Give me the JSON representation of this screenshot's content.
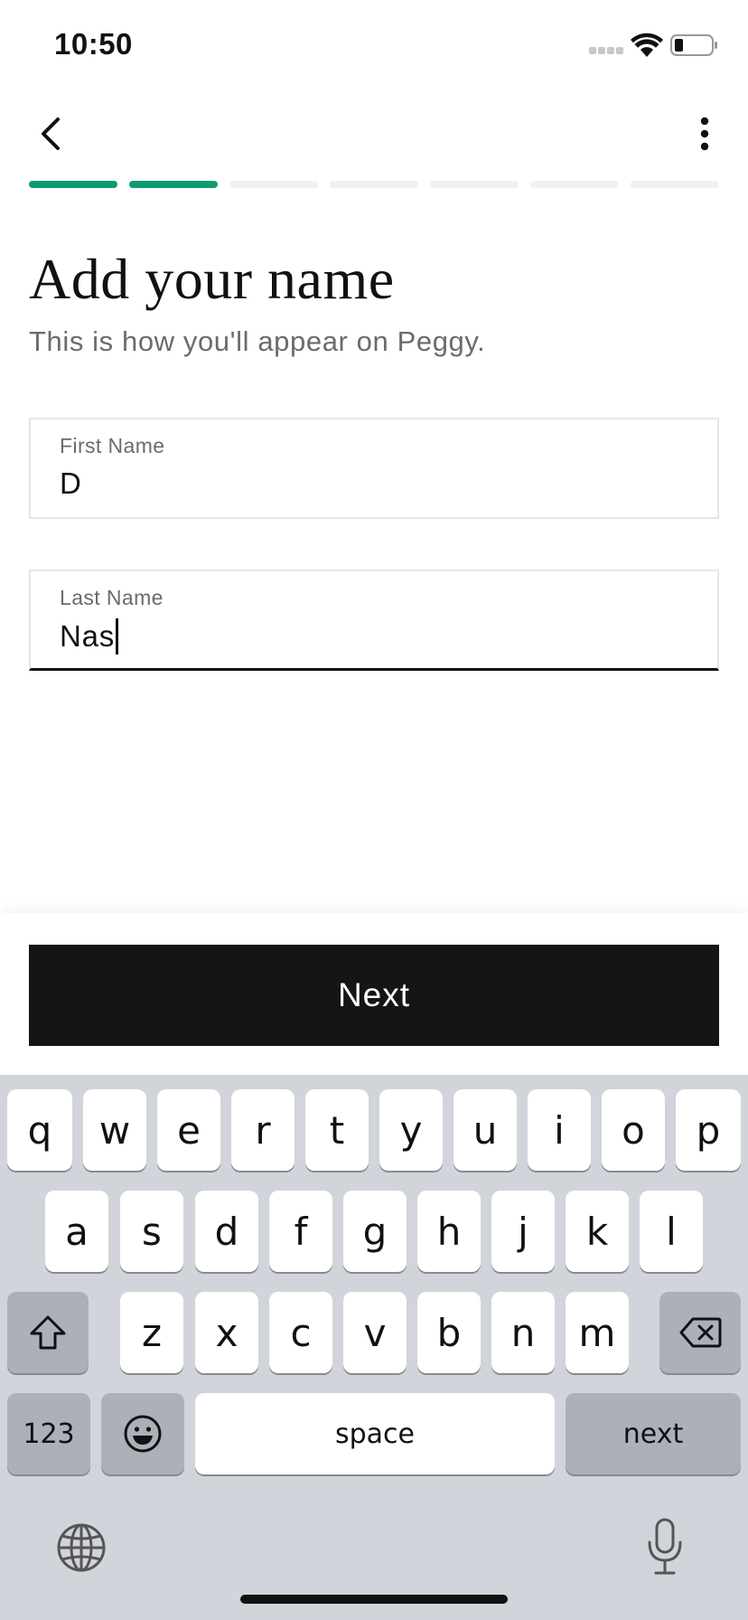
{
  "status_bar": {
    "time": "10:50"
  },
  "progress": {
    "total_steps": 7,
    "completed_steps": 2,
    "accent": "#0f9b72"
  },
  "header": {
    "title": "Add your name",
    "subtitle": "This is how you'll appear on Peggy."
  },
  "form": {
    "first_name": {
      "label": "First Name",
      "value": "D"
    },
    "last_name": {
      "label": "Last Name",
      "value": "Nas"
    }
  },
  "actions": {
    "next_label": "Next"
  },
  "keyboard": {
    "row1": [
      "q",
      "w",
      "e",
      "r",
      "t",
      "y",
      "u",
      "i",
      "o",
      "p"
    ],
    "row2": [
      "a",
      "s",
      "d",
      "f",
      "g",
      "h",
      "j",
      "k",
      "l"
    ],
    "row3": [
      "z",
      "x",
      "c",
      "v",
      "b",
      "n",
      "m"
    ],
    "numbers_label": "123",
    "space_label": "space",
    "return_label": "next"
  },
  "icons": {
    "back": "chevron-left-icon",
    "more": "vertical-ellipsis-icon",
    "shift": "shift-arrow-icon",
    "delete": "backspace-icon",
    "emoji": "emoji-smile-icon",
    "globe": "globe-icon",
    "mic": "microphone-icon"
  }
}
